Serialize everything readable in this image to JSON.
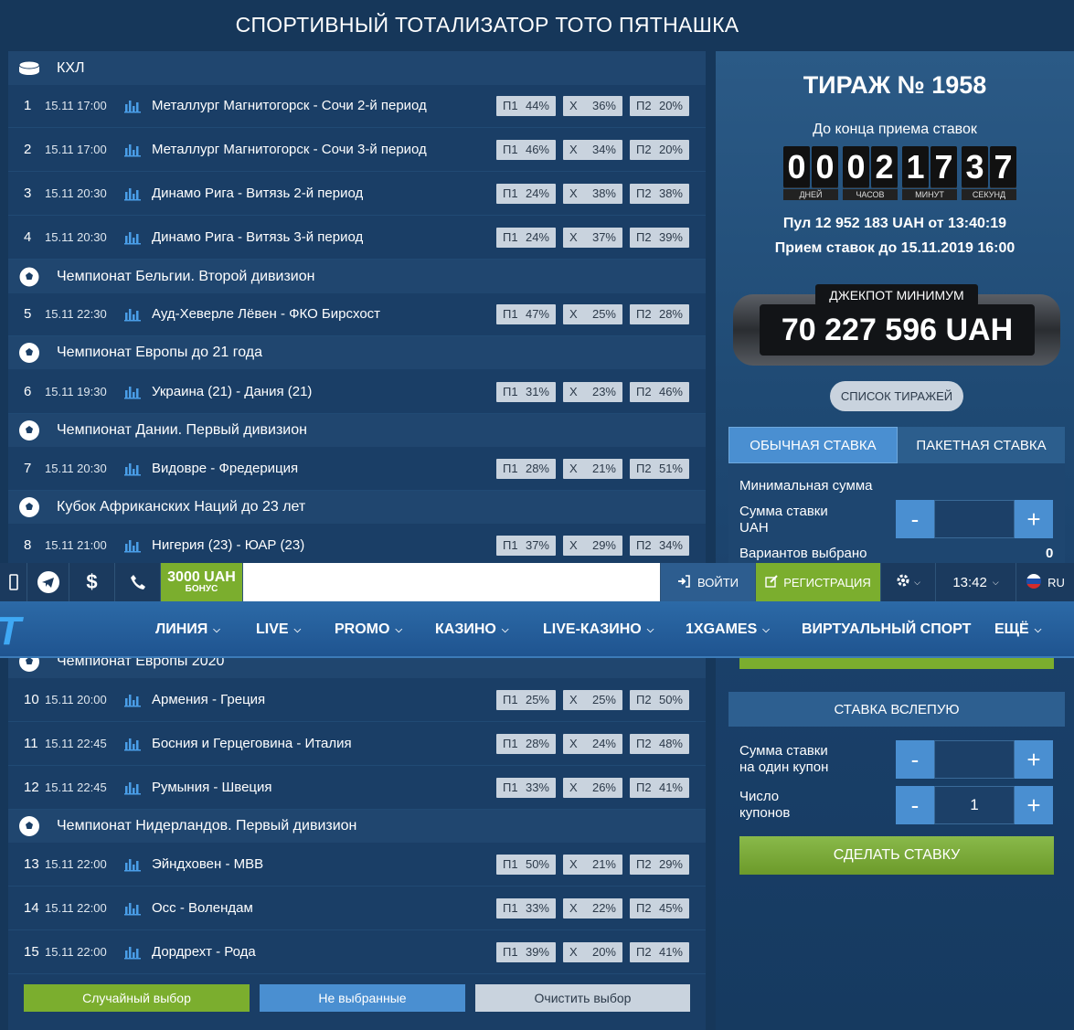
{
  "page_title": "СПОРТИВНЫЙ ТОТАЛИЗАТОР ТОТО ПЯТНАШКА",
  "groups": [
    {
      "name": "КХЛ",
      "icon": "hockey-puck-icon"
    },
    {
      "name": "Чемпионат Бельгии. Второй дивизион",
      "icon": "soccer-ball-icon"
    },
    {
      "name": "Чемпионат Европы до 21 года",
      "icon": "soccer-ball-icon"
    },
    {
      "name": "Чемпионат Дании. Первый дивизион",
      "icon": "soccer-ball-icon"
    },
    {
      "name": "Кубок Африканских Наций до 23 лет",
      "icon": "soccer-ball-icon"
    },
    {
      "name": "Чемпионат Европы 2020",
      "icon": "soccer-ball-icon"
    },
    {
      "name": "Чемпионат Нидерландов. Первый дивизион",
      "icon": "soccer-ball-icon"
    }
  ],
  "matches": [
    {
      "num": "1",
      "dt": "15.11 17:00",
      "name": "Металлург Магнитогорск - Сочи 2-й период",
      "p1": "44%",
      "x": "36%",
      "p2": "20%"
    },
    {
      "num": "2",
      "dt": "15.11 17:00",
      "name": "Металлург Магнитогорск - Сочи 3-й период",
      "p1": "46%",
      "x": "34%",
      "p2": "20%"
    },
    {
      "num": "3",
      "dt": "15.11 20:30",
      "name": "Динамо Рига - Витязь 2-й период",
      "p1": "24%",
      "x": "38%",
      "p2": "38%"
    },
    {
      "num": "4",
      "dt": "15.11 20:30",
      "name": "Динамо Рига - Витязь 3-й период",
      "p1": "24%",
      "x": "37%",
      "p2": "39%"
    },
    {
      "num": "5",
      "dt": "15.11 22:30",
      "name": "Ауд-Хеверле Лёвен - ФКО Бирсхост",
      "p1": "47%",
      "x": "25%",
      "p2": "28%"
    },
    {
      "num": "6",
      "dt": "15.11 19:30",
      "name": "Украина (21) - Дания (21)",
      "p1": "31%",
      "x": "23%",
      "p2": "46%"
    },
    {
      "num": "7",
      "dt": "15.11 20:30",
      "name": "Видовре - Фредериция",
      "p1": "28%",
      "x": "21%",
      "p2": "51%"
    },
    {
      "num": "8",
      "dt": "15.11 21:00",
      "name": "Нигерия (23) - ЮАР (23)",
      "p1": "37%",
      "x": "29%",
      "p2": "34%"
    },
    {
      "num": "10",
      "dt": "15.11 20:00",
      "name": "Армения - Греция",
      "p1": "25%",
      "x": "25%",
      "p2": "50%"
    },
    {
      "num": "11",
      "dt": "15.11 22:45",
      "name": "Босния и Герцеговина - Италия",
      "p1": "28%",
      "x": "24%",
      "p2": "48%"
    },
    {
      "num": "12",
      "dt": "15.11 22:45",
      "name": "Румыния - Швеция",
      "p1": "33%",
      "x": "26%",
      "p2": "41%"
    },
    {
      "num": "13",
      "dt": "15.11 22:00",
      "name": "Эйндховен - МВВ",
      "p1": "50%",
      "x": "21%",
      "p2": "29%"
    },
    {
      "num": "14",
      "dt": "15.11 22:00",
      "name": "Осс - Волендам",
      "p1": "33%",
      "x": "22%",
      "p2": "45%"
    },
    {
      "num": "15",
      "dt": "15.11 22:00",
      "name": "Дордрехт - Рода",
      "p1": "39%",
      "x": "20%",
      "p2": "41%"
    }
  ],
  "odd_labels": {
    "p1": "П1",
    "x": "Х",
    "p2": "П2"
  },
  "bottom_buttons": {
    "random": "Случайный выбор",
    "unselected": "Не выбранные",
    "clear": "Очистить выбор"
  },
  "draw": {
    "title": "ТИРАЖ № 1958",
    "deadline_label": "До конца приема ставок",
    "timer": {
      "days": [
        "0",
        "0"
      ],
      "hours": [
        "0",
        "2"
      ],
      "minutes": [
        "1",
        "7"
      ],
      "seconds": [
        "3",
        "7"
      ],
      "labels": {
        "days": "ДНЕЙ",
        "hours": "ЧАСОВ",
        "minutes": "МИНУТ",
        "seconds": "СЕКУНД"
      }
    },
    "pool": "Пул 12 952 183 UAH от 13:40:19",
    "accept_until": "Прием ставок до 15.11.2019 16:00",
    "jackpot_label": "ДЖЕКПОТ МИНИМУМ",
    "jackpot_value": "70 227 596 UAH",
    "draw_list_button": "СПИСОК ТИРАЖЕЙ"
  },
  "bet_tabs": {
    "regular": "ОБЫЧНАЯ СТАВКА",
    "package": "ПАКЕТНАЯ СТАВКА"
  },
  "bet_form": {
    "min_sum": "Минимальная сумма",
    "sum_label_1": "Сумма ставки",
    "sum_label_2": "UAH",
    "variants_label": "Вариантов выбрано",
    "variants_value": "0",
    "minus": "-",
    "plus": "+",
    "sum_value": ""
  },
  "blind_bet": {
    "header": "СТАВКА ВСЛЕПУЮ",
    "sum_label_1": "Сумма ставки",
    "sum_label_2": "на один купон",
    "sum_value": "",
    "coupons_label_1": "Число",
    "coupons_label_2": "купонов",
    "coupons_value": "1",
    "make_bet": "СДЕЛАТЬ СТАВКУ"
  },
  "topbar": {
    "bonus_amount": "3000 UAH",
    "bonus_label": "БОНУС",
    "login": "ВОЙТИ",
    "register": "РЕГИСТРАЦИЯ",
    "time": "13:42",
    "lang": "RU"
  },
  "nav": {
    "logo": "T",
    "items": [
      "ЛИНИЯ",
      "LIVE",
      "PROMO",
      "КАЗИНО",
      "LIVE-КАЗИНО",
      "1XGAMES",
      "ВИРТУАЛЬНЫЙ СПОРТ",
      "ЕЩЁ"
    ]
  },
  "colors": {
    "background": "#16375a",
    "odd_bg": "#c9d3de",
    "green": "#7bae2e",
    "accent_blue": "#4a8fd1"
  }
}
